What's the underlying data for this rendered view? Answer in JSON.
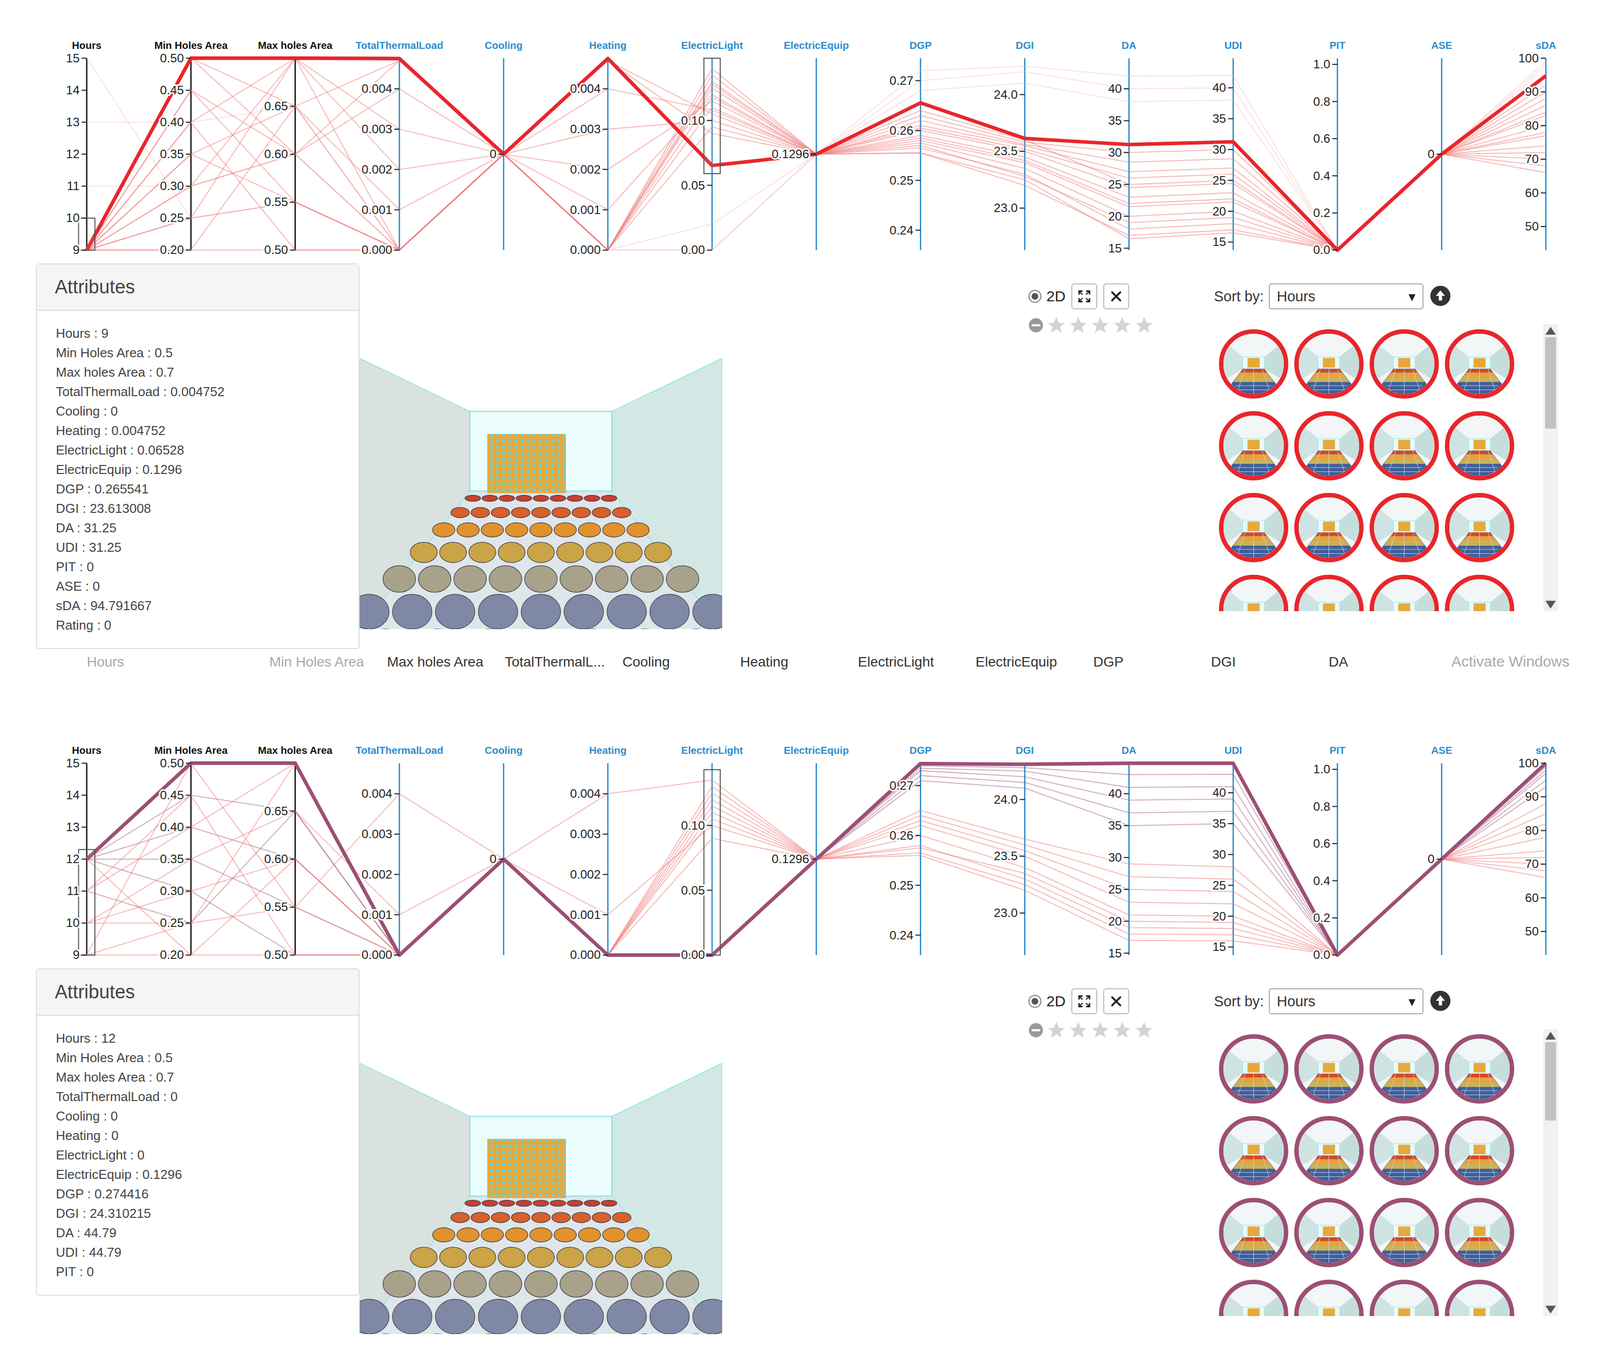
{
  "axes": [
    {
      "name": "Hours",
      "kind": "input",
      "min": 9,
      "max": 15,
      "ticks": [
        "9",
        "10",
        "11",
        "12",
        "13",
        "14",
        "15"
      ]
    },
    {
      "name": "Min Holes Area",
      "kind": "input",
      "min": 0.2,
      "max": 0.5,
      "ticks": [
        "0.20",
        "0.25",
        "0.30",
        "0.35",
        "0.40",
        "0.45",
        "0.50"
      ]
    },
    {
      "name": "Max holes Area",
      "kind": "input",
      "min": 0.5,
      "max": 0.7,
      "ticks": [
        "0.50",
        "0.55",
        "0.60",
        "0.65"
      ]
    },
    {
      "name": "TotalThermalLoad",
      "kind": "output",
      "min": 0,
      "max": 0.00476,
      "ticks": [
        "0.000",
        "0.001",
        "0.002",
        "0.003",
        "0.004"
      ]
    },
    {
      "name": "Cooling",
      "kind": "output",
      "min": -1,
      "max": 1,
      "ticks": [
        "0"
      ]
    },
    {
      "name": "Heating",
      "kind": "output",
      "min": 0,
      "max": 0.00476,
      "ticks": [
        "0.000",
        "0.001",
        "0.002",
        "0.003",
        "0.004"
      ]
    },
    {
      "name": "ElectricLight",
      "kind": "output",
      "min": 0,
      "max": 0.148,
      "ticks": [
        "0.00",
        "0.05",
        "0.10"
      ]
    },
    {
      "name": "ElectricEquip",
      "kind": "output",
      "min": 0,
      "max": 0.2592,
      "ticks": [
        "0.1296"
      ]
    },
    {
      "name": "DGP",
      "kind": "output",
      "min": 0.236,
      "max": 0.2745,
      "ticks": [
        "0.24",
        "0.25",
        "0.26",
        "0.27"
      ]
    },
    {
      "name": "DGI",
      "kind": "output",
      "min": 22.63,
      "max": 24.32,
      "ticks": [
        "23.0",
        "23.5",
        "24.0"
      ]
    },
    {
      "name": "DA",
      "kind": "output",
      "min": 14.7,
      "max": 44.8,
      "ticks": [
        "15",
        "20",
        "25",
        "30",
        "35",
        "40"
      ]
    },
    {
      "name": "UDI",
      "kind": "output",
      "min": 13.7,
      "max": 44.8,
      "ticks": [
        "15",
        "20",
        "25",
        "30",
        "35",
        "40"
      ]
    },
    {
      "name": "PIT",
      "kind": "output",
      "min": 0,
      "max": 1.033,
      "ticks": [
        "0.0",
        "0.2",
        "0.4",
        "0.6",
        "0.8",
        "1.0"
      ]
    },
    {
      "name": "ASE",
      "kind": "output",
      "min": -1,
      "max": 1,
      "ticks": [
        "0"
      ]
    },
    {
      "name": "sDA",
      "kind": "output",
      "min": 43,
      "max": 100,
      "ticks": [
        "50",
        "60",
        "70",
        "80",
        "90",
        "100"
      ]
    }
  ],
  "panels": [
    {
      "color": "#e8262b",
      "highlight": [
        9,
        0.5,
        0.7,
        0.004752,
        0,
        0.004752,
        0.06528,
        0.1296,
        0.265541,
        23.613008,
        31.25,
        31.25,
        0,
        0,
        94.791667
      ],
      "lines": [
        {
          "kind": "faded",
          "values": [
            11,
            0.3,
            0.6,
            0,
            0,
            0,
            0,
            0.1296,
            0.27,
            24.2,
            40,
            40,
            0,
            0,
            98
          ]
        },
        {
          "kind": "faded",
          "values": [
            13,
            0.4,
            0.65,
            0,
            0,
            0,
            0,
            0.1296,
            0.272,
            24.25,
            42,
            42,
            0,
            0,
            99
          ]
        },
        {
          "kind": "faded",
          "values": [
            15,
            0.25,
            0.55,
            0,
            0,
            0,
            0.02,
            0.1296,
            0.268,
            24.1,
            38,
            38,
            0,
            0,
            97
          ]
        },
        {
          "kind": "brushed",
          "values": [
            9,
            0.2,
            0.5,
            0,
            0,
            0,
            0.135,
            0.1296,
            0.2555,
            23.25,
            16.5,
            16.5,
            0,
            0,
            66
          ]
        },
        {
          "kind": "brushed",
          "values": [
            9,
            0.25,
            0.55,
            0,
            0,
            0,
            0.13,
            0.1296,
            0.2565,
            23.3,
            18,
            18,
            0,
            0,
            70
          ]
        },
        {
          "kind": "brushed",
          "values": [
            9,
            0.3,
            0.6,
            0,
            0,
            0,
            0.125,
            0.1296,
            0.2575,
            23.35,
            20,
            20,
            0,
            0,
            74
          ]
        },
        {
          "kind": "brushed",
          "values": [
            9,
            0.35,
            0.65,
            0.001,
            0,
            0.001,
            0.12,
            0.1296,
            0.258,
            23.4,
            21.5,
            21.5,
            0,
            0,
            77
          ]
        },
        {
          "kind": "brushed",
          "values": [
            9,
            0.4,
            0.7,
            0.002,
            0,
            0.002,
            0.115,
            0.1296,
            0.259,
            23.45,
            23,
            23,
            0,
            0,
            80
          ]
        },
        {
          "kind": "brushed",
          "values": [
            9,
            0.45,
            0.55,
            0,
            0,
            0,
            0.11,
            0.1296,
            0.26,
            23.5,
            24.5,
            24.5,
            0,
            0,
            83
          ]
        },
        {
          "kind": "brushed",
          "values": [
            9,
            0.5,
            0.6,
            0.0047,
            0,
            0.0047,
            0.105,
            0.1296,
            0.2605,
            23.52,
            26,
            26,
            0,
            0,
            86
          ]
        },
        {
          "kind": "brushed",
          "values": [
            9,
            0.2,
            0.65,
            0,
            0,
            0,
            0.14,
            0.1296,
            0.2555,
            23.2,
            17,
            17,
            0,
            0,
            68
          ]
        },
        {
          "kind": "brushed",
          "values": [
            9,
            0.3,
            0.7,
            0.003,
            0,
            0.003,
            0.1,
            0.1296,
            0.261,
            23.55,
            27,
            27,
            0,
            0,
            88
          ]
        },
        {
          "kind": "brushed",
          "values": [
            9,
            0.4,
            0.5,
            0,
            0,
            0,
            0.095,
            0.1296,
            0.262,
            23.56,
            28.5,
            28.5,
            0,
            0,
            90
          ]
        },
        {
          "kind": "brushed",
          "values": [
            9,
            0.5,
            0.65,
            0.0047,
            0,
            0.0047,
            0.09,
            0.1296,
            0.263,
            23.58,
            30,
            30,
            0,
            0,
            92
          ]
        },
        {
          "kind": "brushed",
          "values": [
            9,
            0.25,
            0.7,
            0,
            0,
            0,
            0.128,
            0.1296,
            0.257,
            23.28,
            19,
            19,
            0,
            0,
            72
          ]
        },
        {
          "kind": "brushed",
          "values": [
            9,
            0.35,
            0.55,
            0,
            0,
            0,
            0.118,
            0.1296,
            0.2585,
            23.42,
            22,
            22,
            0,
            0,
            78
          ]
        },
        {
          "kind": "brushed",
          "values": [
            9,
            0.45,
            0.6,
            0.004,
            0,
            0.004,
            0.108,
            0.1296,
            0.264,
            23.6,
            25,
            25,
            0,
            0,
            84
          ]
        }
      ],
      "brushes": [
        {
          "axis": "Hours",
          "from": 9,
          "to": 10
        },
        {
          "axis": "ElectricLight",
          "from": 0.059,
          "to": 0.148
        }
      ],
      "attributes_title": "Attributes",
      "attributes": [
        "Hours : 9",
        "Min Holes Area : 0.5",
        "Max holes Area : 0.7",
        "TotalThermalLoad : 0.004752",
        "Cooling : 0",
        "Heating : 0.004752",
        "ElectricLight : 0.06528",
        "ElectricEquip : 0.1296",
        "DGP : 0.265541",
        "DGI : 23.613008",
        "DA : 31.25",
        "UDI : 31.25",
        "PIT : 0",
        "ASE : 0",
        "sDA : 94.791667",
        "Rating : 0"
      ],
      "view_toggle": {
        "label": "2D",
        "selected": true
      },
      "rating": {
        "stars": 0,
        "max": 5
      },
      "sort": {
        "label": "Sort by:",
        "value": "Hours",
        "arrow": "▾"
      },
      "thumbnails": [
        {
          "highlighted": true
        },
        {
          "highlighted": true
        },
        {
          "highlighted": true
        },
        {
          "highlighted": true
        },
        {
          "highlighted": true
        },
        {
          "highlighted": true
        },
        {
          "highlighted": true
        },
        {
          "highlighted": true
        },
        {
          "highlighted": true
        },
        {
          "highlighted": true
        },
        {
          "highlighted": true
        },
        {
          "highlighted": true
        },
        {
          "highlighted": true
        },
        {
          "highlighted": true
        },
        {
          "highlighted": true
        },
        {
          "highlighted": true
        }
      ],
      "scroll": {
        "level": 0.35
      },
      "header_row": [
        {
          "text": "Hours",
          "muted": true
        },
        {
          "text": "Min Holes Area",
          "muted": true
        },
        {
          "text": "Max holes Area",
          "muted": false
        },
        {
          "text": "TotalThermalL...",
          "muted": false
        },
        {
          "text": "Cooling",
          "muted": false
        },
        {
          "text": "Heating",
          "muted": false
        },
        {
          "text": "ElectricLight",
          "muted": false
        },
        {
          "text": "ElectricEquip",
          "muted": false
        },
        {
          "text": "DGP",
          "muted": false
        },
        {
          "text": "DGI",
          "muted": false
        },
        {
          "text": "DA",
          "muted": false
        }
      ],
      "watermark": "Activate Windows"
    },
    {
      "color": "#9c4f74",
      "highlight": [
        12,
        0.5,
        0.7,
        0,
        0,
        0,
        0,
        0.1296,
        0.274416,
        24.310215,
        44.79,
        44.79,
        0,
        0,
        100
      ],
      "lines": [
        {
          "kind": "group",
          "values": [
            12,
            0.45,
            0.65,
            0,
            0,
            0,
            0,
            0.1296,
            0.274,
            24.28,
            43,
            43,
            0,
            0,
            99
          ]
        },
        {
          "kind": "group",
          "values": [
            12,
            0.4,
            0.6,
            0,
            0,
            0,
            0,
            0.1296,
            0.2735,
            24.25,
            41,
            41,
            0,
            0,
            98
          ]
        },
        {
          "kind": "group",
          "values": [
            12,
            0.35,
            0.55,
            0,
            0,
            0,
            0,
            0.1296,
            0.273,
            24.2,
            39,
            39,
            0,
            0,
            97
          ]
        },
        {
          "kind": "group",
          "values": [
            12,
            0.3,
            0.5,
            0,
            0,
            0,
            0,
            0.1296,
            0.272,
            24.15,
            37,
            37,
            0,
            0,
            95
          ]
        },
        {
          "kind": "group",
          "values": [
            11,
            0.25,
            0.65,
            0,
            0,
            0,
            0,
            0.1296,
            0.271,
            24.1,
            35,
            35,
            0,
            0,
            93
          ]
        },
        {
          "kind": "brushed",
          "values": [
            9,
            0.2,
            0.5,
            0,
            0,
            0,
            0.13,
            0.1296,
            0.256,
            23.2,
            17,
            16,
            0,
            0,
            66
          ]
        },
        {
          "kind": "brushed",
          "values": [
            9,
            0.25,
            0.55,
            0,
            0,
            0,
            0.12,
            0.1296,
            0.258,
            23.3,
            19,
            18,
            0,
            0,
            70
          ]
        },
        {
          "kind": "brushed",
          "values": [
            10,
            0.3,
            0.6,
            0,
            0,
            0,
            0.11,
            0.1296,
            0.26,
            23.4,
            21,
            20,
            0,
            0,
            74
          ]
        },
        {
          "kind": "brushed",
          "values": [
            10,
            0.35,
            0.65,
            0.001,
            0,
            0.001,
            0.1,
            0.1296,
            0.262,
            23.5,
            23,
            22,
            0,
            0,
            78
          ]
        },
        {
          "kind": "brushed",
          "values": [
            11,
            0.4,
            0.7,
            0,
            0,
            0,
            0.09,
            0.1296,
            0.263,
            23.55,
            25,
            24,
            0,
            0,
            82
          ]
        },
        {
          "kind": "brushed",
          "values": [
            11,
            0.45,
            0.5,
            0,
            0,
            0,
            0.125,
            0.1296,
            0.264,
            23.6,
            27,
            26,
            0,
            0,
            85
          ]
        },
        {
          "kind": "brushed",
          "values": [
            9,
            0.5,
            0.55,
            0.004,
            0,
            0.004,
            0.135,
            0.1296,
            0.2565,
            23.25,
            18,
            17,
            0,
            0,
            68
          ]
        },
        {
          "kind": "brushed",
          "values": [
            12,
            0.2,
            0.6,
            0,
            0,
            0,
            0.115,
            0.1296,
            0.265,
            23.65,
            29,
            28,
            0,
            0,
            88
          ]
        },
        {
          "kind": "brushed",
          "values": [
            10,
            0.25,
            0.7,
            0,
            0,
            0,
            0.105,
            0.1296,
            0.2575,
            23.35,
            20,
            19,
            0,
            0,
            72
          ]
        }
      ],
      "brushes": [
        {
          "axis": "Hours",
          "from": 9,
          "to": 12.3
        },
        {
          "axis": "ElectricLight",
          "from": 0,
          "to": 0.143
        }
      ],
      "attributes_title": "Attributes",
      "attributes": [
        "Hours : 12",
        "Min Holes Area : 0.5",
        "Max holes Area : 0.7",
        "TotalThermalLoad : 0",
        "Cooling : 0",
        "Heating : 0",
        "ElectricLight : 0",
        "ElectricEquip : 0.1296",
        "DGP : 0.274416",
        "DGI : 24.310215",
        "DA : 44.79",
        "UDI : 44.79",
        "PIT : 0"
      ],
      "view_toggle": {
        "label": "2D",
        "selected": true
      },
      "rating": {
        "stars": 0,
        "max": 5
      },
      "sort": {
        "label": "Sort by:",
        "value": "Hours",
        "arrow": "▾"
      },
      "thumbnails": [
        {
          "highlighted": true
        },
        {
          "highlighted": true
        },
        {
          "highlighted": true
        },
        {
          "highlighted": true
        },
        {
          "highlighted": true
        },
        {
          "highlighted": true
        },
        {
          "highlighted": true
        },
        {
          "highlighted": true
        },
        {
          "highlighted": true
        },
        {
          "highlighted": true
        },
        {
          "highlighted": true
        },
        {
          "highlighted": true
        },
        {
          "highlighted": true
        },
        {
          "highlighted": true
        },
        {
          "highlighted": true
        },
        {
          "highlighted": true
        }
      ],
      "scroll": {
        "level": 0.3
      }
    }
  ]
}
